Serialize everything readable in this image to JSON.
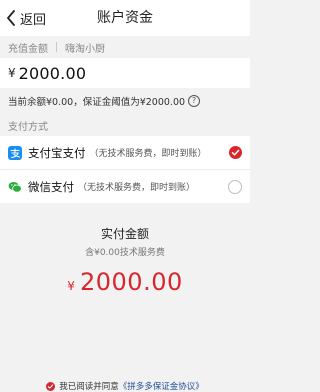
{
  "nav": {
    "back_label": "返回",
    "title": "账户资金"
  },
  "recharge": {
    "label": "充值金额",
    "shop_name": "嗨淘小厨"
  },
  "amount": {
    "currency": "¥",
    "value": "2000.00"
  },
  "balance_note": "当前余额¥0.00，保证金阈值为¥2000.00",
  "payment": {
    "section_label": "支付方式",
    "options": [
      {
        "name": "支付宝支付",
        "desc": "（无技术服务费，即时到账）",
        "selected": true,
        "icon": "alipay-icon"
      },
      {
        "name": "微信支付",
        "desc": "（无技术服务费，即时到账）",
        "selected": false,
        "icon": "wechat-pay-icon"
      }
    ]
  },
  "summary": {
    "title": "实付金额",
    "fee_note": "含¥0.00技术服务费",
    "currency": "¥",
    "total": "2000.00"
  },
  "agreement": {
    "prefix": "我已阅读并同意",
    "link_text": "《拼多多保证金协议》"
  },
  "colors": {
    "accent": "#d7262d",
    "alipay": "#1a8ef0",
    "wechat": "#2aae3b",
    "link": "#1f4e96"
  }
}
